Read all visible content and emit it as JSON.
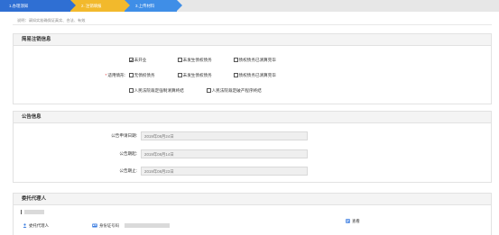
{
  "steps": [
    {
      "label": "1.办理须知",
      "color": "#2f6fd3"
    },
    {
      "label": "2. 注销填报",
      "color": "#f2b92c"
    },
    {
      "label": "3.上传材料",
      "color": "#3f8ee7"
    }
  ],
  "note": "说明：请如实准确保证真实、合法、有效",
  "section1": {
    "title": "简易注销信息",
    "checkbox_not_opened": "未开业",
    "checkbox_no_debt": "未发生债权债务",
    "checkbox_debt_cleared": "债权债务已清算完毕",
    "applicable_label": "适用情形:",
    "checkbox_no_creditor": "无债权债务",
    "checkbox_no_debt2": "未发生债权债务",
    "checkbox_debt_cleared2": "债权债务已清算完毕",
    "checkbox_court_liquidation": "人民法院裁定强制清算终结",
    "checkbox_court_bankruptcy": "人民法院裁定破产程序终结"
  },
  "section2": {
    "title": "公告信息",
    "apply_date_label": "公告申请日期:",
    "apply_date_value": "2019年08月24日",
    "start_date_label": "公告期起:",
    "start_date_value": "2019年08月14日",
    "end_date_label": "公告期止:",
    "end_date_value": "2019年08月23日"
  },
  "section3": {
    "title": "委托代理人",
    "agent_role": "委托代理人",
    "id_label": "身份证号码",
    "view_label": "查看"
  }
}
